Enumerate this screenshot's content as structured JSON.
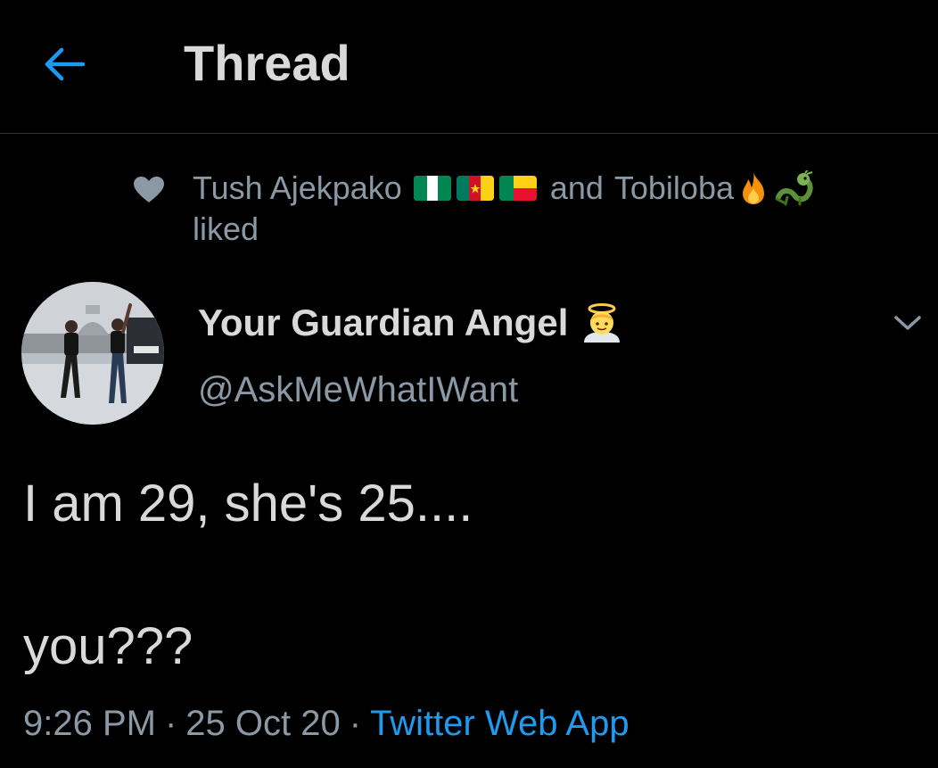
{
  "header": {
    "title": "Thread",
    "back_icon": "arrow-left-icon",
    "accent_color": "#1d9bf0"
  },
  "social_context": {
    "icon": "heart-icon",
    "user1": "Tush Ajekpako",
    "user1_emojis": [
      "flag-nigeria",
      "flag-cameroon",
      "flag-benin"
    ],
    "connector": "and",
    "user2": "Tobiloba",
    "user2_emojis": [
      "fire",
      "dragon"
    ],
    "action": "liked"
  },
  "tweet": {
    "author_name": "Your Guardian Angel",
    "author_emoji": "angel-emoji",
    "author_handle": "@AskMeWhatIWant",
    "text_line1": "I am 29, she's 25....",
    "text_line2": "you???",
    "time": "9:26 PM",
    "date": "25 Oct 20",
    "separator": "·",
    "source": "Twitter Web App"
  }
}
